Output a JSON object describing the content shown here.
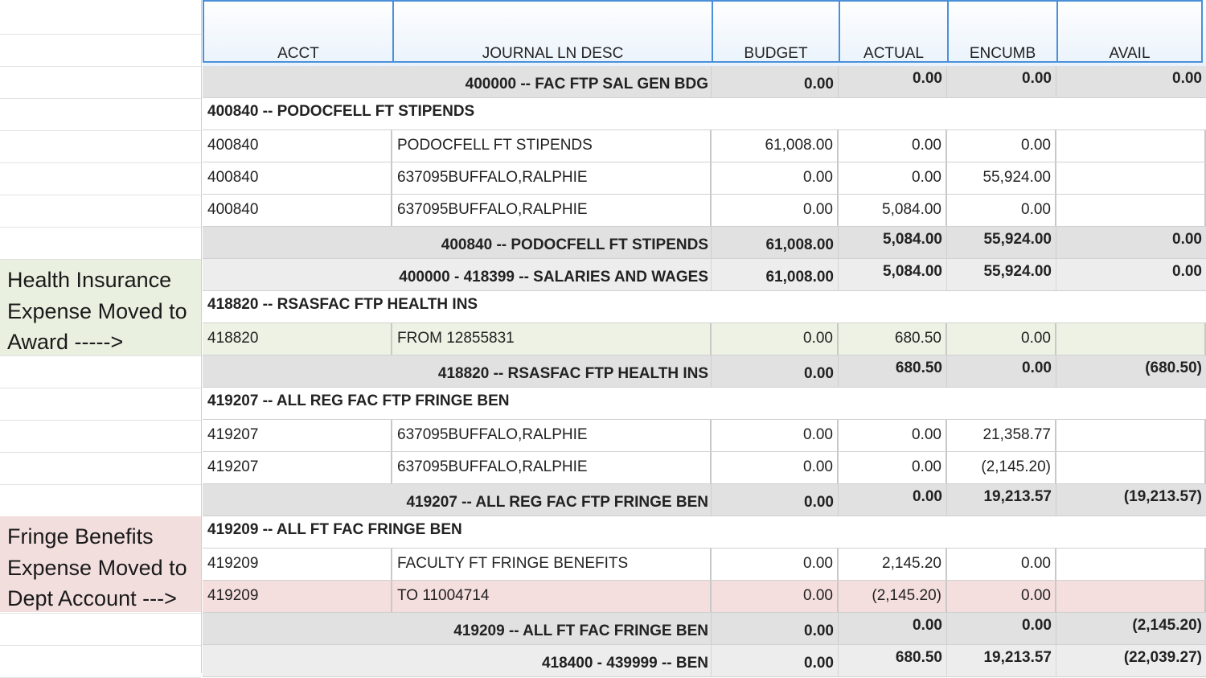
{
  "columns": [
    "ACCT",
    "JOURNAL LN DESC",
    "BUDGET",
    "ACTUAL",
    "ENCUMB",
    "AVAIL"
  ],
  "annotations": {
    "health": [
      "Health Insurance",
      "Expense Moved to",
      "Award ----->"
    ],
    "fringe": [
      "Fringe Benefits",
      "Expense Moved to",
      "Dept Account --->"
    ]
  },
  "rows": [
    {
      "type": "subtotal",
      "label": "400000 -- FAC FTP SAL GEN BDG",
      "budget": "0.00",
      "actual": "0.00",
      "encumb": "0.00",
      "avail": "0.00"
    },
    {
      "type": "heading",
      "label": "400840 -- PODOCFELL FT STIPENDS"
    },
    {
      "type": "detail",
      "acct": "400840",
      "desc": "PODOCFELL FT STIPENDS",
      "budget": "61,008.00",
      "actual": "0.00",
      "encumb": "0.00",
      "avail": ""
    },
    {
      "type": "detail",
      "acct": "400840",
      "desc": "637095BUFFALO,RALPHIE",
      "budget": "0.00",
      "actual": "0.00",
      "encumb": "55,924.00",
      "avail": ""
    },
    {
      "type": "detail",
      "acct": "400840",
      "desc": "637095BUFFALO,RALPHIE",
      "budget": "0.00",
      "actual": "5,084.00",
      "encumb": "0.00",
      "avail": ""
    },
    {
      "type": "subtotal",
      "label": "400840 -- PODOCFELL FT STIPENDS",
      "budget": "61,008.00",
      "actual": "5,084.00",
      "encumb": "55,924.00",
      "avail": "0.00"
    },
    {
      "type": "grandtotal",
      "label": "400000 - 418399 -- SALARIES AND WAGES",
      "budget": "61,008.00",
      "actual": "5,084.00",
      "encumb": "55,924.00",
      "avail": "0.00"
    },
    {
      "type": "heading",
      "label": "418820 -- RSASFAC FTP HEALTH INS"
    },
    {
      "type": "detail-green",
      "acct": "418820",
      "desc": "FROM 12855831",
      "budget": "0.00",
      "actual": "680.50",
      "encumb": "0.00",
      "avail": ""
    },
    {
      "type": "subtotal",
      "label": "418820 -- RSASFAC FTP HEALTH INS",
      "budget": "0.00",
      "actual": "680.50",
      "encumb": "0.00",
      "avail": "(680.50)"
    },
    {
      "type": "heading",
      "label": "419207 -- ALL REG FAC FTP FRINGE BEN"
    },
    {
      "type": "detail",
      "acct": "419207",
      "desc": "637095BUFFALO,RALPHIE",
      "budget": "0.00",
      "actual": "0.00",
      "encumb": "21,358.77",
      "avail": ""
    },
    {
      "type": "detail",
      "acct": "419207",
      "desc": "637095BUFFALO,RALPHIE",
      "budget": "0.00",
      "actual": "0.00",
      "encumb": "(2,145.20)",
      "avail": ""
    },
    {
      "type": "subtotal",
      "label": "419207 -- ALL REG FAC FTP FRINGE BEN",
      "budget": "0.00",
      "actual": "0.00",
      "encumb": "19,213.57",
      "avail": "(19,213.57)"
    },
    {
      "type": "heading",
      "label": "419209 -- ALL FT FAC FRINGE BEN"
    },
    {
      "type": "detail",
      "acct": "419209",
      "desc": "FACULTY FT FRINGE BENEFITS",
      "budget": "0.00",
      "actual": "2,145.20",
      "encumb": "0.00",
      "avail": ""
    },
    {
      "type": "detail-pink",
      "acct": "419209",
      "desc": "TO 11004714",
      "budget": "0.00",
      "actual": "(2,145.20)",
      "encumb": "0.00",
      "avail": ""
    },
    {
      "type": "subtotal",
      "label": "419209 -- ALL FT FAC FRINGE BEN",
      "budget": "0.00",
      "actual": "0.00",
      "encumb": "0.00",
      "avail": "(2,145.20)"
    },
    {
      "type": "grandtotal",
      "label": "418400 - 439999 -- BEN",
      "budget": "0.00",
      "actual": "680.50",
      "encumb": "19,213.57",
      "avail": "(22,039.27)"
    }
  ]
}
